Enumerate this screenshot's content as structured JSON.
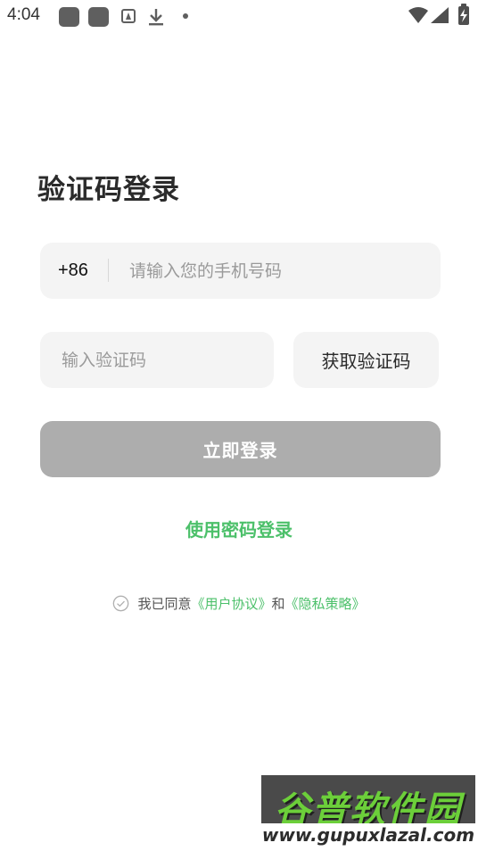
{
  "status_bar": {
    "time": "4:04",
    "icons": [
      "app-square-icon",
      "app-square-icon",
      "font-a-icon",
      "download-icon",
      "dot-icon",
      "wifi-icon",
      "signal-icon",
      "battery-charging-icon"
    ]
  },
  "title": "验证码登录",
  "phone": {
    "country_code": "+86",
    "placeholder": "请输入您的手机号码"
  },
  "code": {
    "placeholder": "输入验证码",
    "get_code_label": "获取验证码"
  },
  "login_label": "立即登录",
  "password_login_label": "使用密码登录",
  "agreement": {
    "prefix": "我已同意",
    "user_agreement": "《用户协议》",
    "and": "和",
    "privacy_policy": "《隐私策略》"
  },
  "colors": {
    "accent_green": "#4cc06a",
    "disabled_button": "#adadad",
    "field_bg": "#f4f4f4"
  },
  "watermark": {
    "top_text": "谷普软件园",
    "bottom_text": "www.gupuxlazal.com"
  }
}
